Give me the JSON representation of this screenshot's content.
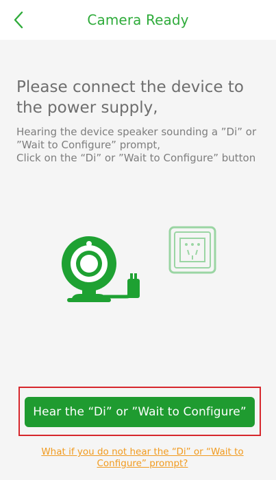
{
  "header": {
    "title": "Camera Ready"
  },
  "instructions": {
    "heading": "Please connect the device to the power supply,",
    "description_line1": "Hearing the device speaker sounding a ”Di” or ”Wait to Configure” prompt,",
    "description_line2": "Click on the “Di” or ”Wait to Configure” button"
  },
  "actions": {
    "primary_label": "Hear the “Di” or ”Wait to Configure”",
    "help_link": "What if you do not hear the “Di” or “Wait to Configure” prompt?"
  },
  "colors": {
    "accent": "#1f9b30",
    "title_green": "#2eab3a",
    "highlight": "#d6262b",
    "link": "#f19a1e"
  },
  "icons": {
    "back": "chevron-left-icon",
    "camera": "webcam-icon",
    "outlet": "power-outlet-icon"
  }
}
